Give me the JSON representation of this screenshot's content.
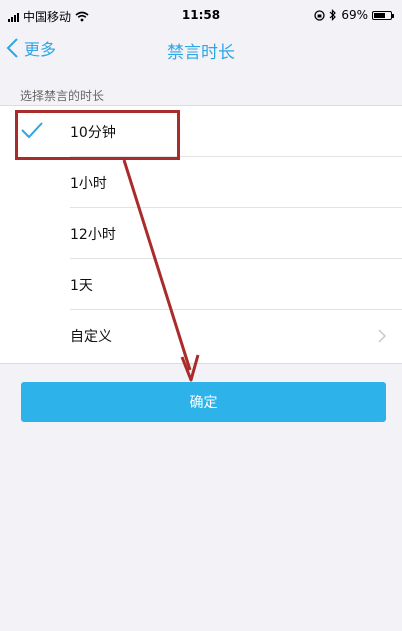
{
  "status_bar": {
    "carrier": "中国移动",
    "time": "11:58",
    "battery_percent": "69%",
    "battery_level": 0.69
  },
  "nav": {
    "back_label": "更多",
    "title": "禁言时长"
  },
  "section": {
    "label": "选择禁言的时长"
  },
  "options": [
    {
      "label": "10分钟",
      "selected": true
    },
    {
      "label": "1小时",
      "selected": false
    },
    {
      "label": "12小时",
      "selected": false
    },
    {
      "label": "1天",
      "selected": false
    },
    {
      "label": "自定义",
      "selected": false
    }
  ],
  "confirm_label": "确定",
  "colors": {
    "accent": "#2fa6e6",
    "button": "#2db3ea",
    "annotation": "#a92b2a"
  }
}
